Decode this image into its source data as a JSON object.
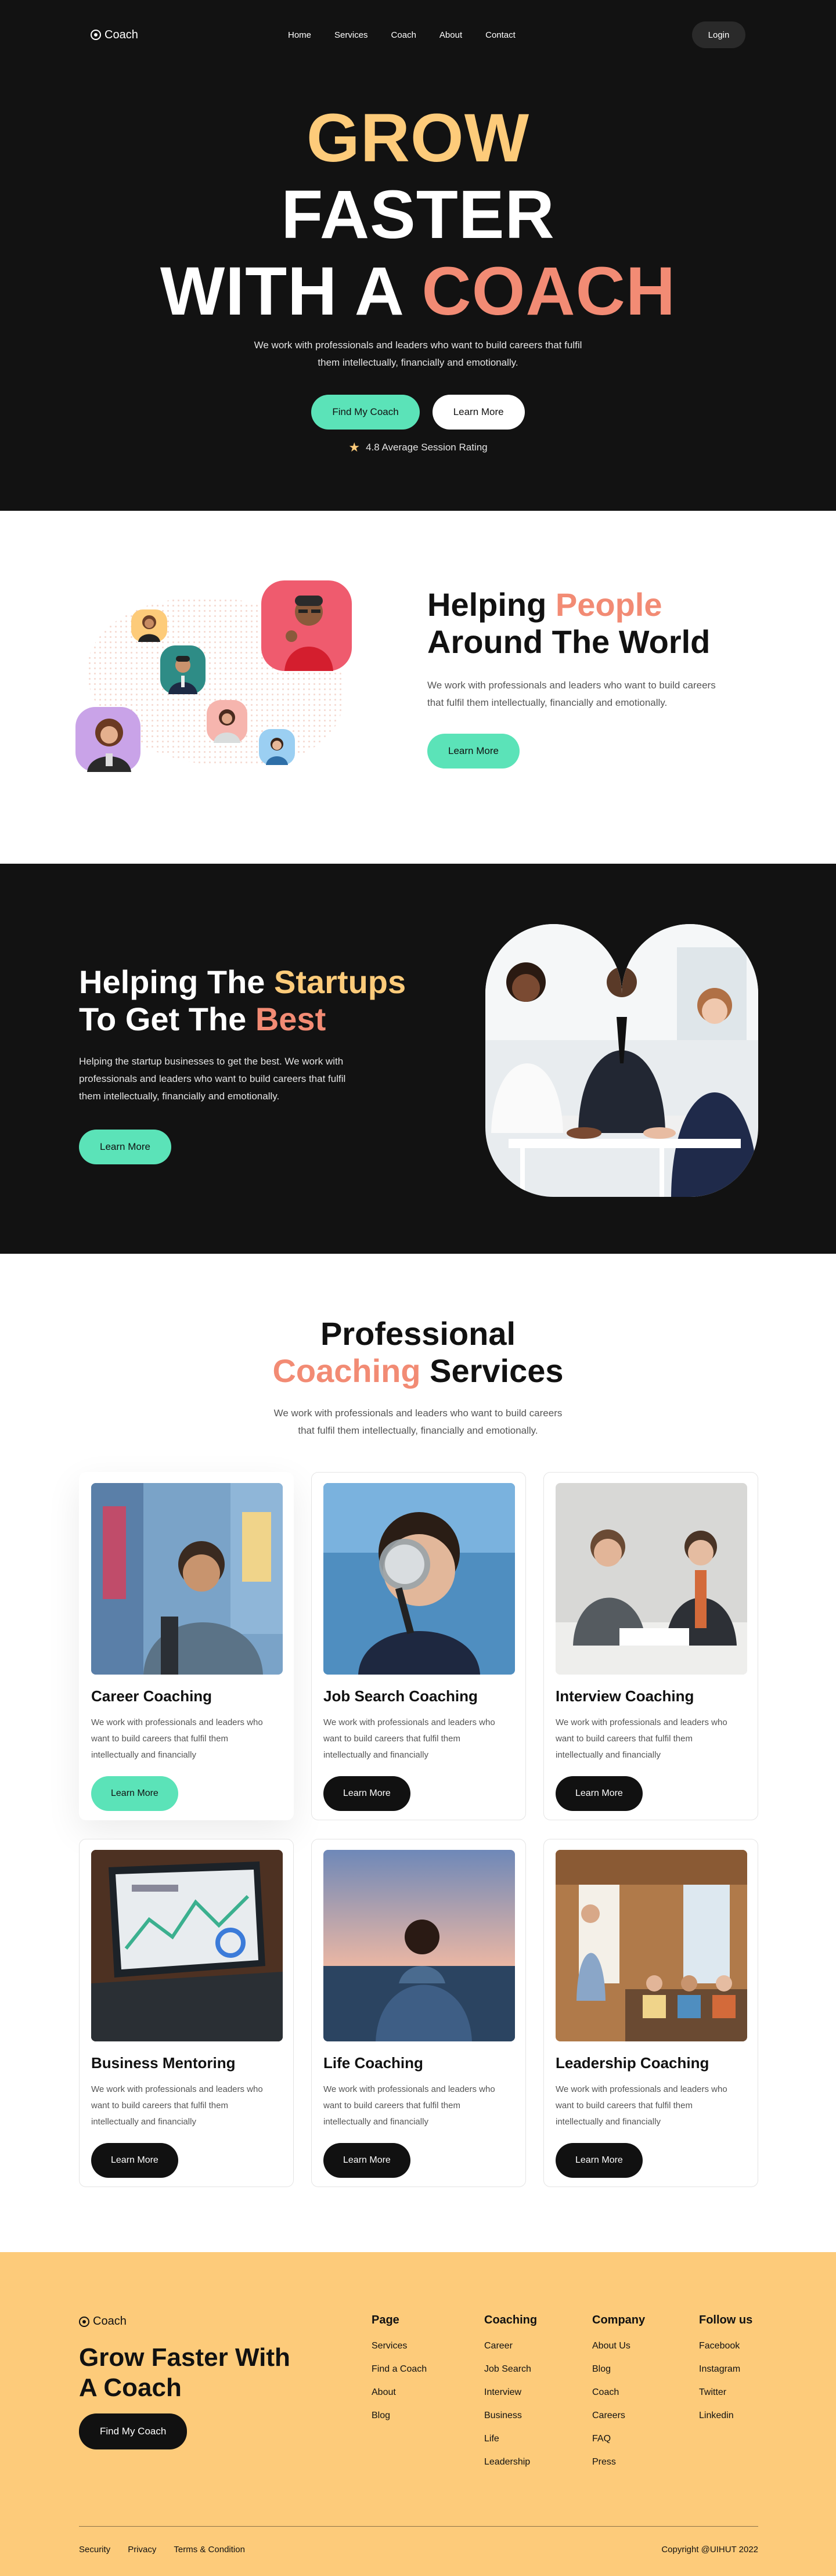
{
  "brand": {
    "name": "Coach"
  },
  "nav": {
    "links": [
      "Home",
      "Services",
      "Coach",
      "About",
      "Contact"
    ],
    "login": "Login"
  },
  "hero": {
    "title_line1": "GROW",
    "title_line2": "FASTER",
    "title_line3_a": "WITH A ",
    "title_line3_b": "COACH",
    "desc_line1": "We work with professionals and leaders who want to build careers that fulfil",
    "desc_line2": "them intellectually, financially and emotionally.",
    "primary_btn": "Find My Coach",
    "secondary_btn": "Learn More",
    "rating": "4.8 Average Session Rating"
  },
  "people": {
    "title_a": "Helping ",
    "title_b": "People",
    "title_c": "Around The World",
    "desc_line1": "We work with professionals and leaders who want to build careers",
    "desc_line2": "that fulfil them intellectually, financially and emotionally.",
    "btn": "Learn More"
  },
  "startups": {
    "title_a": "Helping The ",
    "title_b": "Startups",
    "title_c": "To Get The ",
    "title_d": "Best",
    "desc_line1": "Helping the startup businesses to get the best. We work with",
    "desc_line2": "professionals and leaders who want to build careers that fulfil",
    "desc_line3": "them intellectually, financially and emotionally.",
    "btn": "Learn More"
  },
  "services": {
    "title_line1": "Professional",
    "title_line2_a": "Coaching",
    "title_line2_b": " Services",
    "desc_line1": "We work with professionals and leaders who want to build careers",
    "desc_line2": "that fulfil them intellectually, financially and emotionally.",
    "cards": [
      {
        "title": "Career Coaching",
        "desc": "We work with professionals and leaders who want to build careers that fulfil them intellectually and financially",
        "btn": "Learn More"
      },
      {
        "title": "Job Search Coaching",
        "desc": "We work with professionals and leaders who want to build careers that fulfil them intellectually and financially",
        "btn": "Learn More"
      },
      {
        "title": "Interview Coaching",
        "desc": "We work with professionals and leaders who want to build careers that fulfil them intellectually and financially",
        "btn": "Learn More"
      },
      {
        "title": "Business Mentoring",
        "desc": "We work with professionals and leaders who want to build careers that fulfil them intellectually and financially",
        "btn": "Learn More"
      },
      {
        "title": "Life Coaching",
        "desc": "We work with professionals and leaders who want to build careers that fulfil them intellectually and financially",
        "btn": "Learn More"
      },
      {
        "title": "Leadership Coaching",
        "desc": "We work with professionals and leaders who want to build careers that fulfil them intellectually and financially",
        "btn": "Learn More"
      }
    ]
  },
  "footer": {
    "title_line1": "Grow Faster With",
    "title_line2": "A Coach",
    "btn": "Find My Coach",
    "columns": [
      {
        "heading": "Page",
        "links": [
          "Services",
          "Find a Coach",
          "About",
          "Blog"
        ]
      },
      {
        "heading": "Coaching",
        "links": [
          "Career",
          "Job Search",
          "Interview",
          "Business",
          "Life",
          "Leadership"
        ]
      },
      {
        "heading": "Company",
        "links": [
          "About Us",
          "Blog",
          "Coach",
          "Careers",
          "FAQ",
          "Press"
        ]
      },
      {
        "heading": "Follow us",
        "links": [
          "Facebook",
          "Instagram",
          "Twitter",
          "Linkedin"
        ]
      }
    ],
    "bottom_links": [
      "Security",
      "Privacy",
      "Terms & Condition"
    ],
    "copyright": "Copyright @UIHUT 2022"
  },
  "colors": {
    "dark_bg": "#121212",
    "accent_yellow": "#FDCB7A",
    "accent_coral": "#F28B74",
    "accent_green": "#5BE3B8"
  }
}
